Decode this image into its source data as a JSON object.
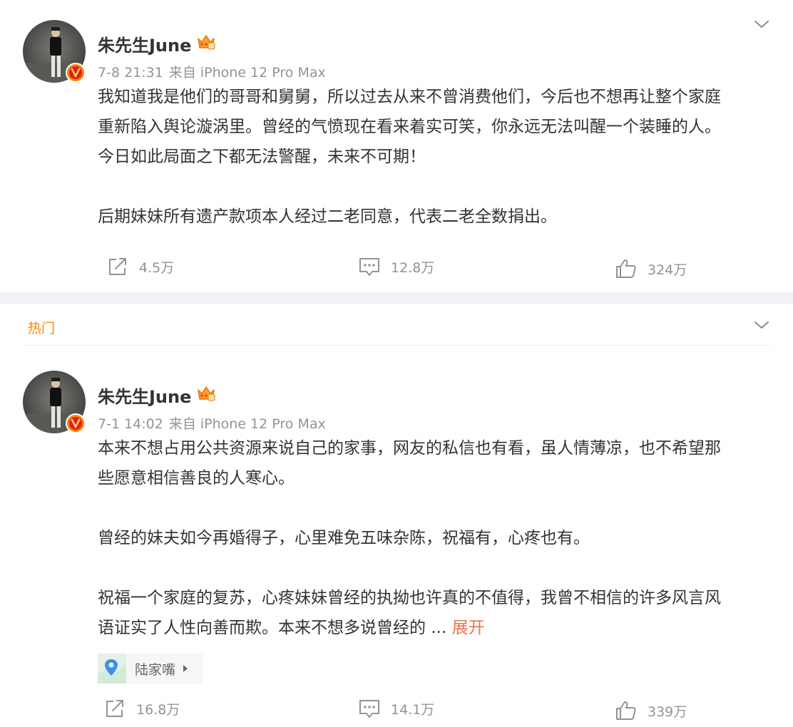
{
  "colors": {
    "accent": "#ff8200",
    "expand": "#eb7350",
    "meta": "#939393",
    "text": "#333333",
    "badge": "#ff8200"
  },
  "posts": [
    {
      "username": "朱先生June",
      "time": "7-8 21:31",
      "source": "来自 iPhone 12 Pro Max",
      "paragraphs": [
        [
          "我知道我是他们的哥哥和舅舅，所以过去从来不曾消费他们，今后也不想再让整个家庭",
          "重新陷入舆论漩涡里。曾经的气愤现在看来着实可笑，你永远无法叫醒一个装睡的人。",
          "今日如此局面之下都无法警醒，未来不可期！"
        ],
        [
          "后期妹妹所有遗产款项本人经过二老同意，代表二老全数捐出。"
        ]
      ],
      "actions": {
        "repost": "4.5万",
        "comment": "12.8万",
        "like": "324万"
      }
    },
    {
      "section_label": "热门",
      "username": "朱先生June",
      "time": "7-1 14:02",
      "source": "来自 iPhone 12 Pro Max",
      "paragraphs": [
        [
          "本来不想占用公共资源来说自己的家事，网友的私信也有看，虽人情薄凉，也不希望那",
          "些愿意相信善良的人寒心。"
        ],
        [
          "曾经的妹夫如今再婚得子，心里难免五味杂陈，祝福有，心疼也有。"
        ],
        [
          "祝福一个家庭的复苏，心疼妹妹曾经的执拗也许真的不值得，我曾不相信的许多风言风",
          "语证实了人性向善而欺。本来不想多说曾经的"
        ]
      ],
      "ellipsis": "...",
      "expand_label": "展开",
      "location": "陆家嘴",
      "actions": {
        "repost": "16.8万",
        "comment": "14.1万",
        "like": "339万"
      }
    }
  ],
  "icons": {
    "collapse": "chevron-down-icon",
    "verified": "verified-badge-icon",
    "membership": "crown-icon",
    "repost": "repost-icon",
    "comment": "comment-icon",
    "like": "like-icon",
    "location": "location-pin-icon"
  }
}
